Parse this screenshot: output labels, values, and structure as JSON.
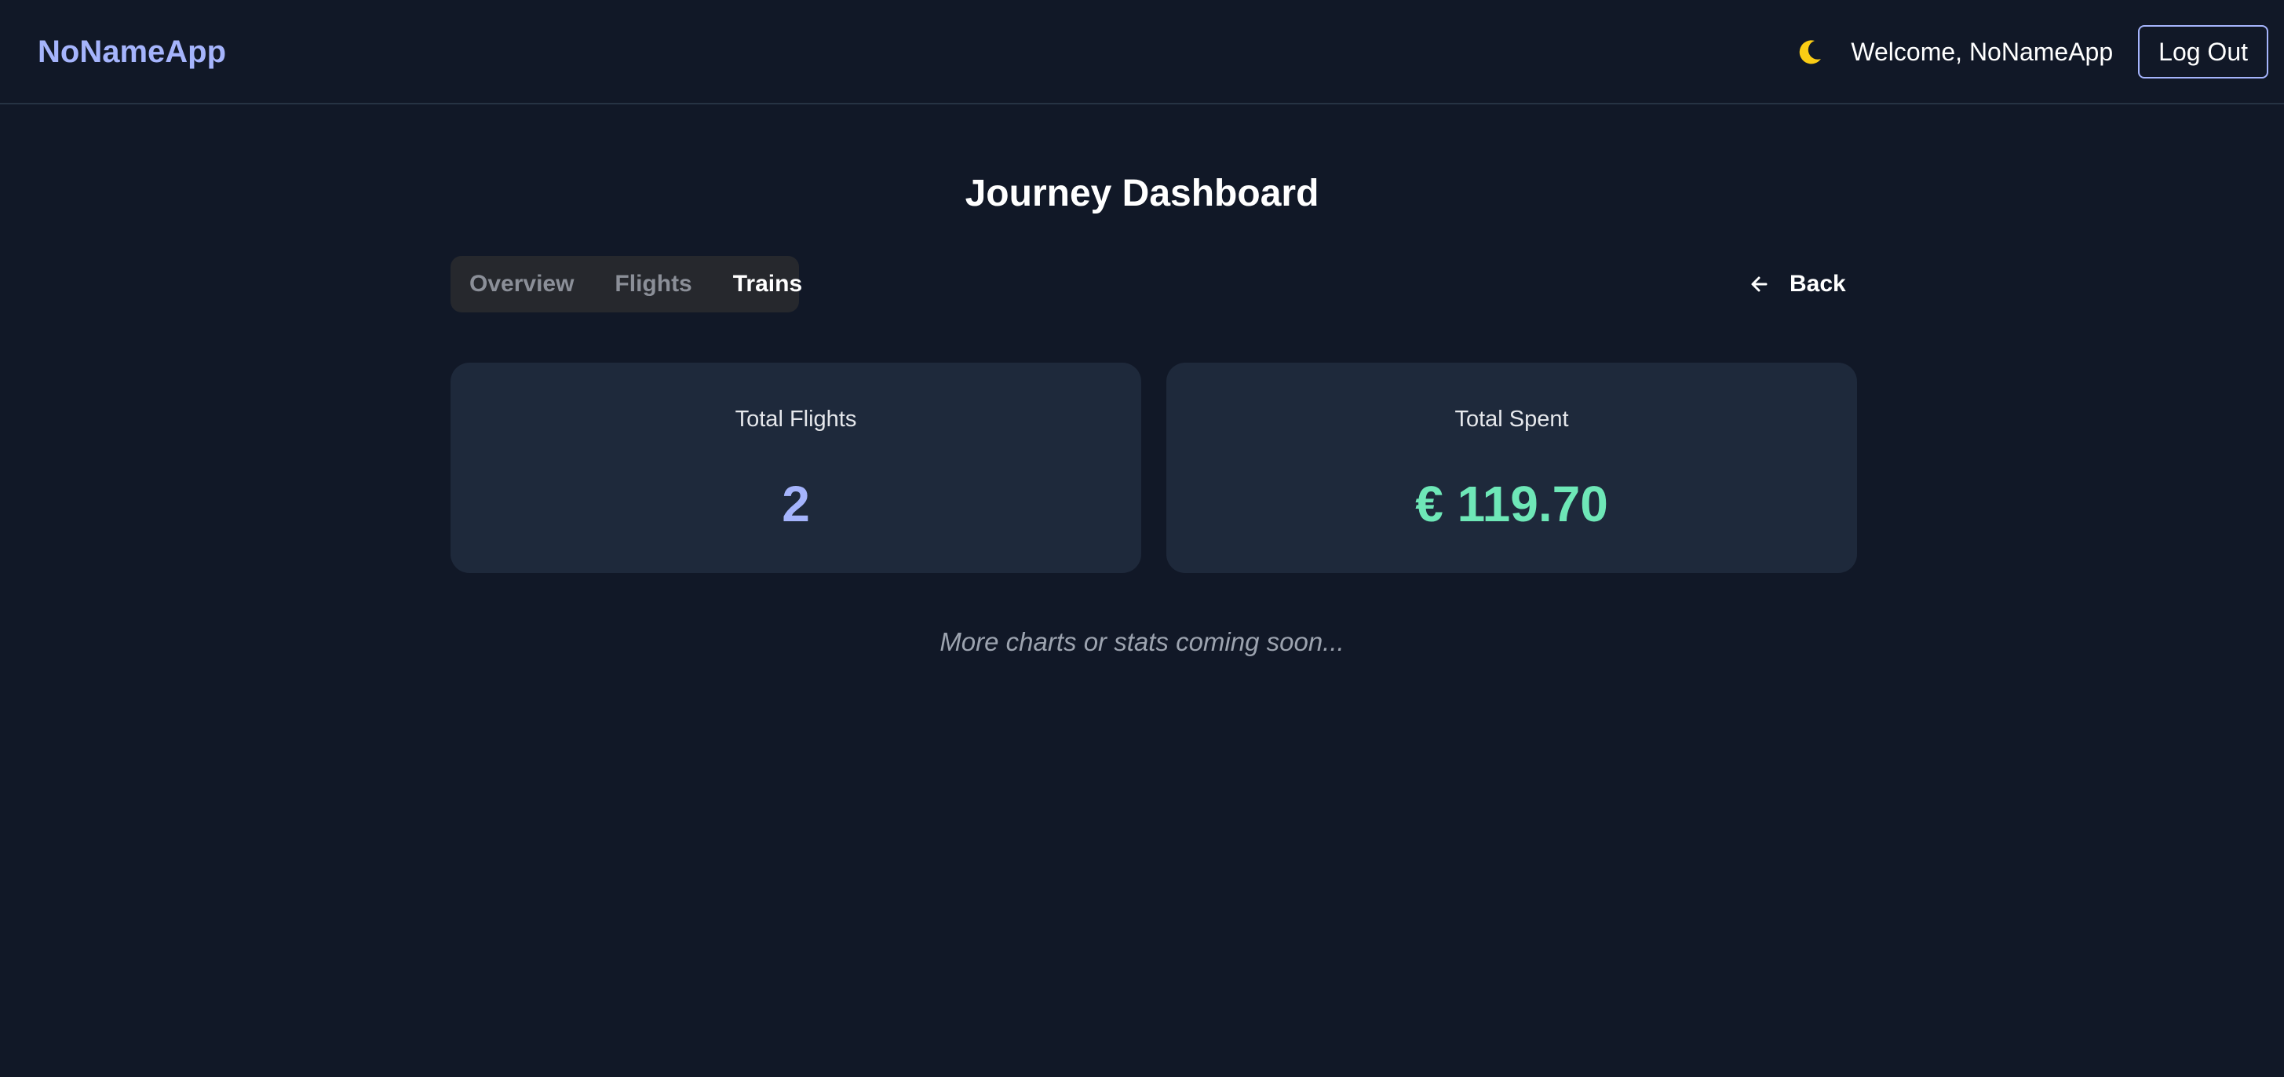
{
  "header": {
    "brand": "NoNameApp",
    "theme_icon": "moon-icon",
    "welcome_text": "Welcome, NoNameApp",
    "logout_label": "Log Out"
  },
  "main": {
    "title": "Journey Dashboard",
    "tabs": [
      {
        "label": "Overview",
        "active": false
      },
      {
        "label": "Flights",
        "active": false
      },
      {
        "label": "Trains",
        "active": true
      }
    ],
    "back_label": "Back",
    "back_icon": "arrow-left-icon",
    "stats": [
      {
        "label": "Total Flights",
        "value": "2"
      },
      {
        "label": "Total Spent",
        "value": "€ 119.70"
      }
    ],
    "footer_note": "More charts or stats coming soon..."
  },
  "colors": {
    "background": "#111827",
    "card": "#1e293b",
    "accent_indigo": "#a5b4fc",
    "accent_green": "#6ee7b7",
    "muted_text": "#9ca3af"
  }
}
